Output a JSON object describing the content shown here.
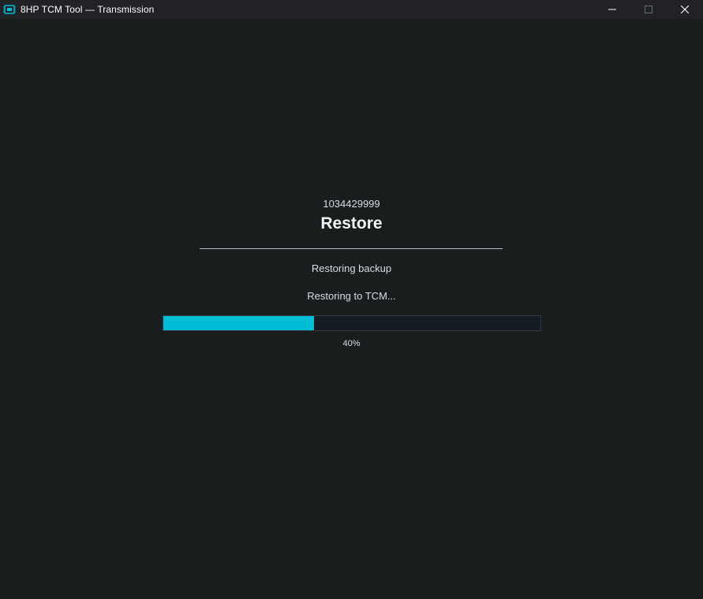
{
  "window": {
    "title": "8HP TCM Tool — Transmission",
    "icon": "tcm-chip-icon",
    "controls": [
      "minimize-icon",
      "maximize-icon",
      "close-icon"
    ],
    "accent_color": "#00bcd4"
  },
  "main": {
    "serial": "1034429999",
    "heading": "Restore",
    "status": "Restoring backup",
    "substatus": "Restoring to TCM...",
    "progress": {
      "value_percent": 40,
      "label": "40%"
    }
  }
}
